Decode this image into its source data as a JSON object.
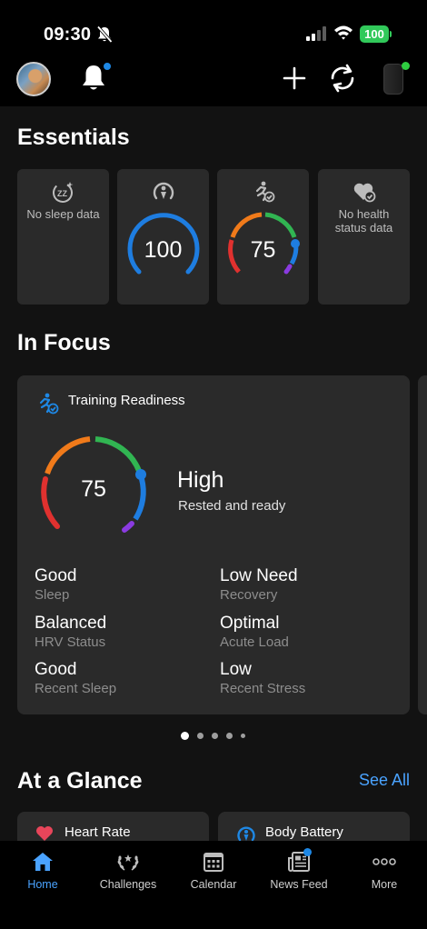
{
  "status_bar": {
    "time": "09:30",
    "battery": "100",
    "icons": [
      "bell-slash-icon",
      "cellular-signal-icon",
      "wifi-icon",
      "battery-icon"
    ]
  },
  "app_bar": {
    "icons": [
      "avatar",
      "notification-bell-icon",
      "plus-icon",
      "sync-icon",
      "watch-device-icon"
    ],
    "notification_badge": true
  },
  "essentials": {
    "title": "Essentials",
    "cards": [
      {
        "icon": "sleep-icon",
        "text": "No sleep data"
      },
      {
        "icon": "body-battery-icon",
        "value": "100",
        "gauge_fraction": 1.0,
        "color": "#1e7de0"
      },
      {
        "icon": "training-readiness-icon",
        "value": "75",
        "gauge_fraction": 0.75
      },
      {
        "icon": "health-status-icon",
        "text": "No health status data"
      }
    ]
  },
  "in_focus": {
    "title": "In Focus",
    "card": {
      "title": "Training Readiness",
      "value": "75",
      "level": "High",
      "description": "Rested and ready",
      "metrics": [
        {
          "value": "Good",
          "label": "Sleep"
        },
        {
          "value": "Low Need",
          "label": "Recovery"
        },
        {
          "value": "Balanced",
          "label": "HRV Status"
        },
        {
          "value": "Optimal",
          "label": "Acute Load"
        },
        {
          "value": "Good",
          "label": "Recent Sleep"
        },
        {
          "value": "Low",
          "label": "Recent Stress"
        }
      ]
    },
    "pager": {
      "count": 5,
      "active_index": 0
    }
  },
  "at_a_glance": {
    "title": "At a Glance",
    "see_all": "See All",
    "cards": [
      {
        "icon": "heart-icon",
        "label": "Heart Rate",
        "color": "#e8455a"
      },
      {
        "icon": "body-battery-icon",
        "label": "Body Battery",
        "color": "#1e88e5"
      }
    ]
  },
  "tab_bar": {
    "tabs": [
      {
        "label": "Home",
        "icon": "home-icon",
        "active": true
      },
      {
        "label": "Challenges",
        "icon": "laurel-icon",
        "active": false
      },
      {
        "label": "Calendar",
        "icon": "calendar-icon",
        "active": false
      },
      {
        "label": "News Feed",
        "icon": "newspaper-icon",
        "active": false,
        "badge": true
      },
      {
        "label": "More",
        "icon": "more-dots-icon",
        "active": false
      }
    ]
  },
  "colors": {
    "accent": "#4aa3ff",
    "readiness_red": "#e0312f",
    "readiness_orange": "#f07a1a",
    "readiness_green": "#31b552",
    "readiness_blue": "#1e7de0",
    "readiness_purple": "#8a3be0"
  }
}
